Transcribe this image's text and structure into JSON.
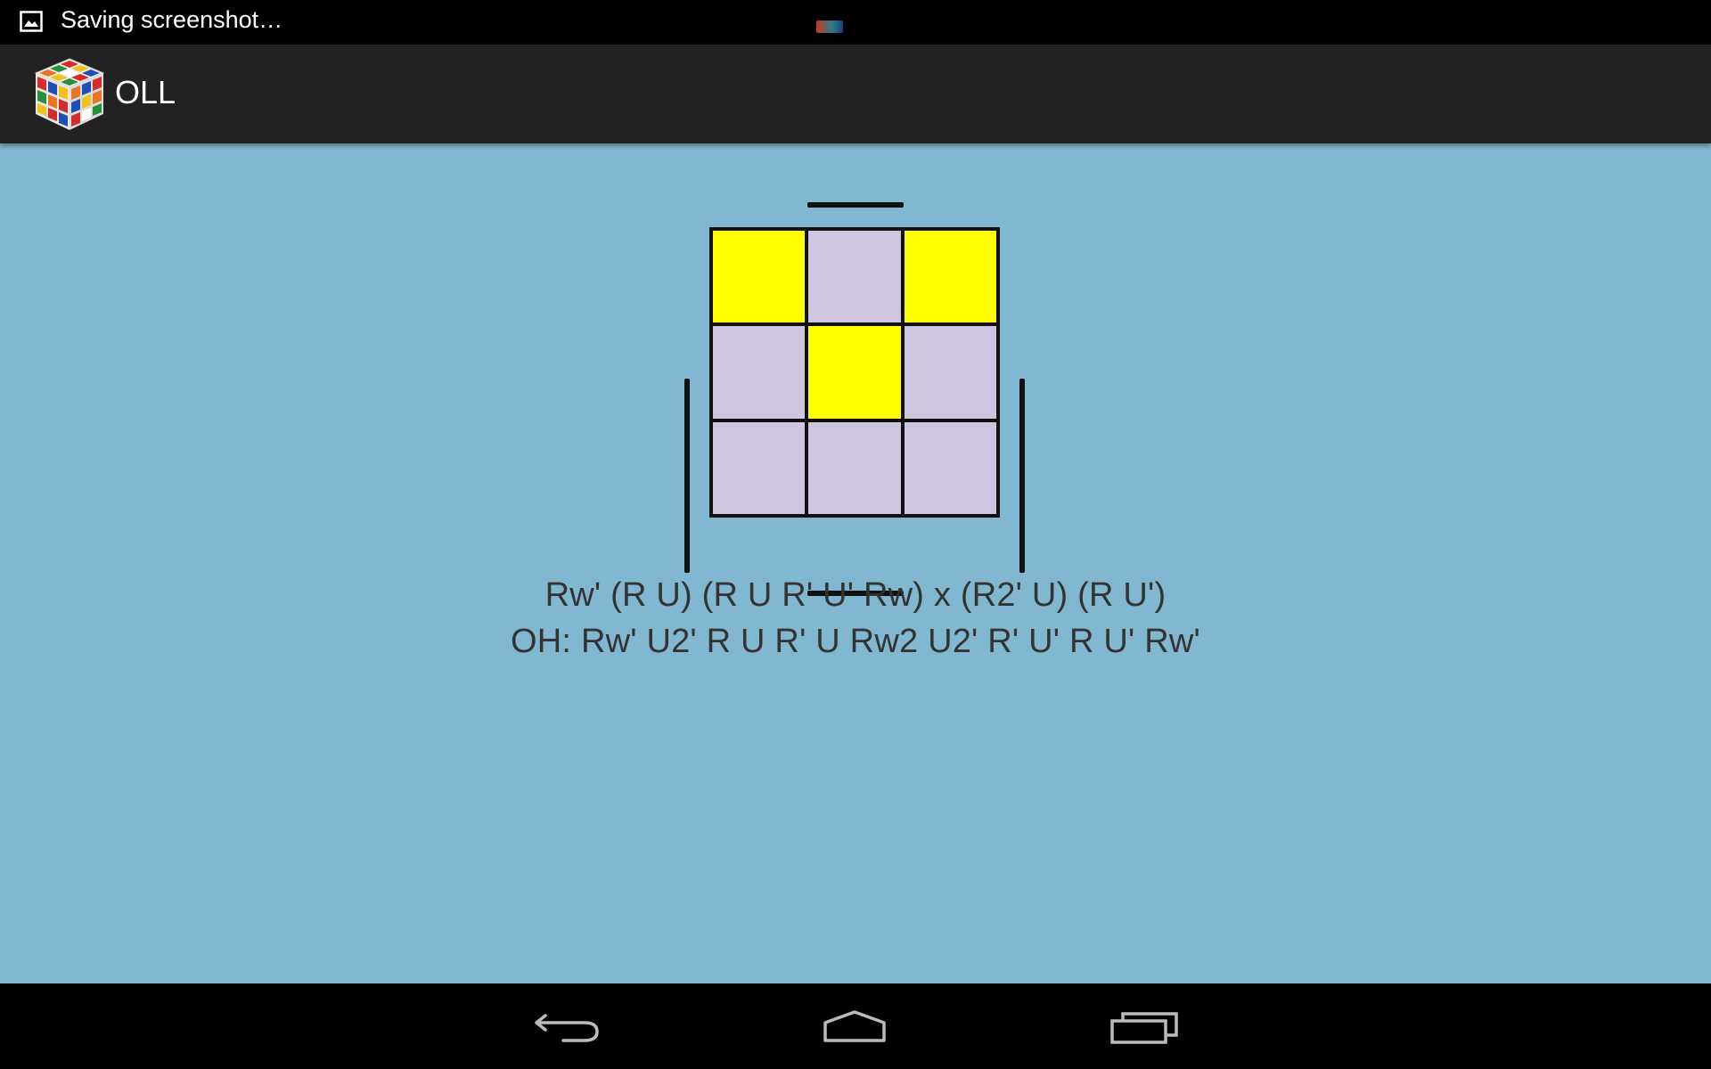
{
  "status_bar": {
    "notification_icon": "image-icon",
    "notification_text": "Saving screenshot…"
  },
  "action_bar": {
    "app_icon": "rubiks-cube-icon",
    "title": "OLL"
  },
  "case": {
    "grid": [
      [
        "yellow",
        "gray",
        "yellow"
      ],
      [
        "gray",
        "yellow",
        "gray"
      ],
      [
        "gray",
        "gray",
        "gray"
      ]
    ],
    "side_markers": [
      "top",
      "bottom",
      "left",
      "right"
    ],
    "colors": {
      "yellow": "#ffff00",
      "gray": "#cec5de",
      "background": "#82b7d1"
    }
  },
  "algorithms": {
    "main": "Rw' (R U) (R U R' U' Rw) x (R2' U) (R U')",
    "one_handed": "OH: Rw' U2' R U R' U Rw2 U2' R' U' R U' Rw'"
  },
  "nav_bar": {
    "back": "back-icon",
    "home": "home-icon",
    "recents": "recents-icon"
  }
}
